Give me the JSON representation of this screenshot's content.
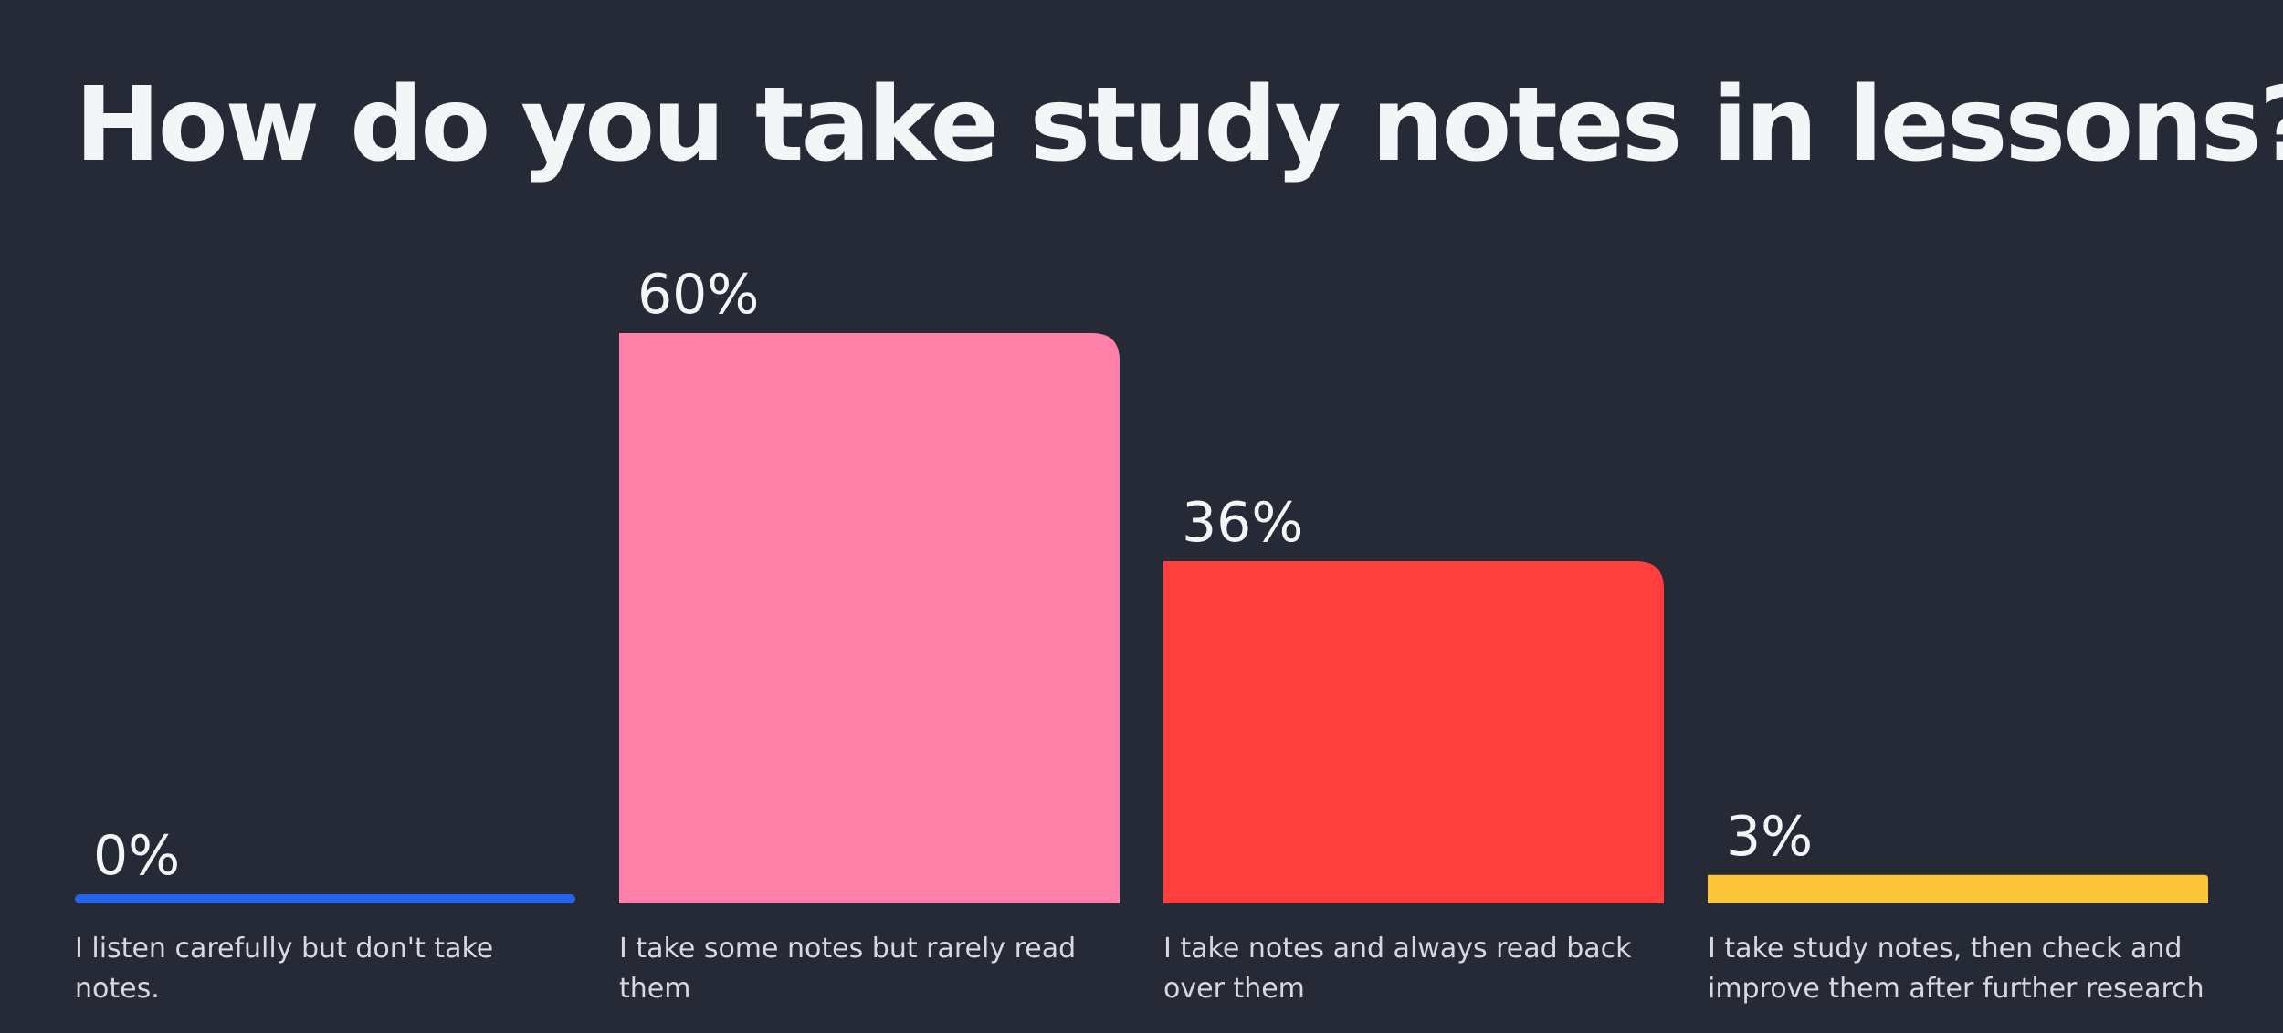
{
  "title": "How do you take study notes in lessons?",
  "chart_data": {
    "type": "bar",
    "categories": [
      "I listen carefully but don't take notes.",
      "I take some notes but rarely read them",
      "I take notes and always read back over them",
      "I take study notes, then check and improve them after further research"
    ],
    "values": [
      0,
      60,
      36,
      3
    ],
    "value_labels": [
      "0%",
      "60%",
      "36%",
      "3%"
    ],
    "colors": [
      "#2563eb",
      "#ff80a8",
      "#ff3f3e",
      "#ffc53a"
    ],
    "ylim": [
      0,
      60
    ],
    "grid": false,
    "legend": "none"
  }
}
